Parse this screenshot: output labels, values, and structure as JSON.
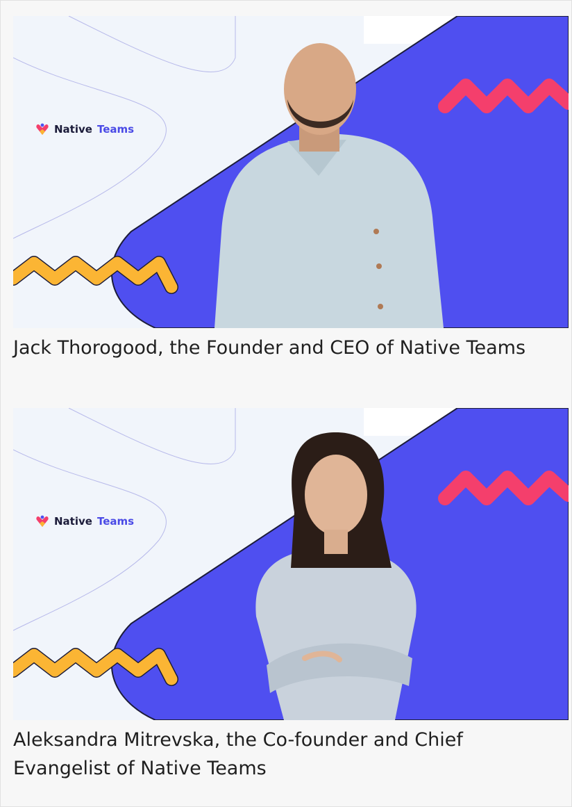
{
  "figures": [
    {
      "logo": {
        "word1": "Native",
        "word2": "Teams",
        "icon": "native-teams-heart-icon"
      },
      "photo_subject": "man-in-light-blue-shirt",
      "caption": "Jack Thorogood, the Founder and CEO of Native Teams"
    },
    {
      "logo": {
        "word1": "Native",
        "word2": "Teams",
        "icon": "native-teams-heart-icon"
      },
      "photo_subject": "woman-in-striped-shirt",
      "caption": "Aleksandra Mitrevska, the Co-founder and Chief Evangelist of Native Teams"
    }
  ],
  "colors": {
    "brand_blue": "#4f4ff0",
    "zigzag_yellow": "#fbb534",
    "zigzag_pink": "#f43f6c",
    "background_light": "#f1f5fb"
  }
}
